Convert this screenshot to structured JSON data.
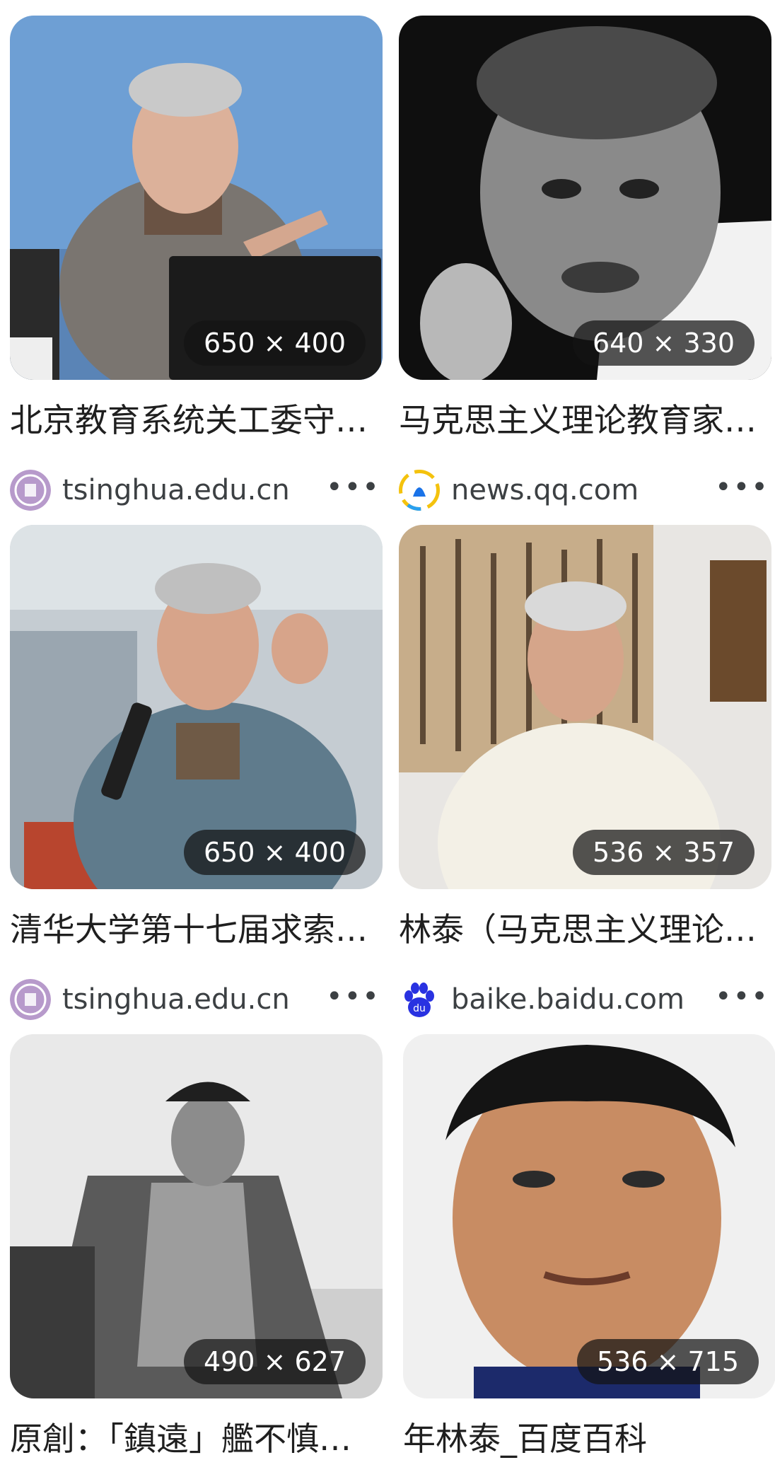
{
  "results": [
    {
      "dimensions": "650 × 400",
      "title": "北京教育系统关工委守…",
      "source": "tsinghua.edu.cn",
      "favicon": "tsinghua-seal-icon",
      "photo": "man-presenting-at-laptop-blue-background"
    },
    {
      "dimensions": "640 × 330",
      "title": "马克思主义理论教育家…",
      "source": "news.qq.com",
      "favicon": "tencent-news-icon",
      "photo": "black-and-white-portrait-man"
    },
    {
      "dimensions": "650 × 400",
      "title": "清华大学第十七届求索…",
      "source": "tsinghua.edu.cn",
      "favicon": "tsinghua-seal-icon",
      "photo": "man-speaking-with-microphone"
    },
    {
      "dimensions": "536 × 357",
      "title": "林泰（马克思主义理论…",
      "source": "baike.baidu.com",
      "favicon": "baidu-paw-icon",
      "photo": "man-in-white-shirt-calligraphy-background"
    },
    {
      "dimensions": "490 × 627",
      "title": "原創：「鎮遠」艦不慎…",
      "source": "",
      "favicon": "",
      "photo": "historical-photo-seated-qing-official"
    },
    {
      "dimensions": "536 × 715",
      "title": "年林泰_百度百科",
      "source": "",
      "favicon": "",
      "photo": "young-man-portrait"
    }
  ],
  "more_label": "•••"
}
